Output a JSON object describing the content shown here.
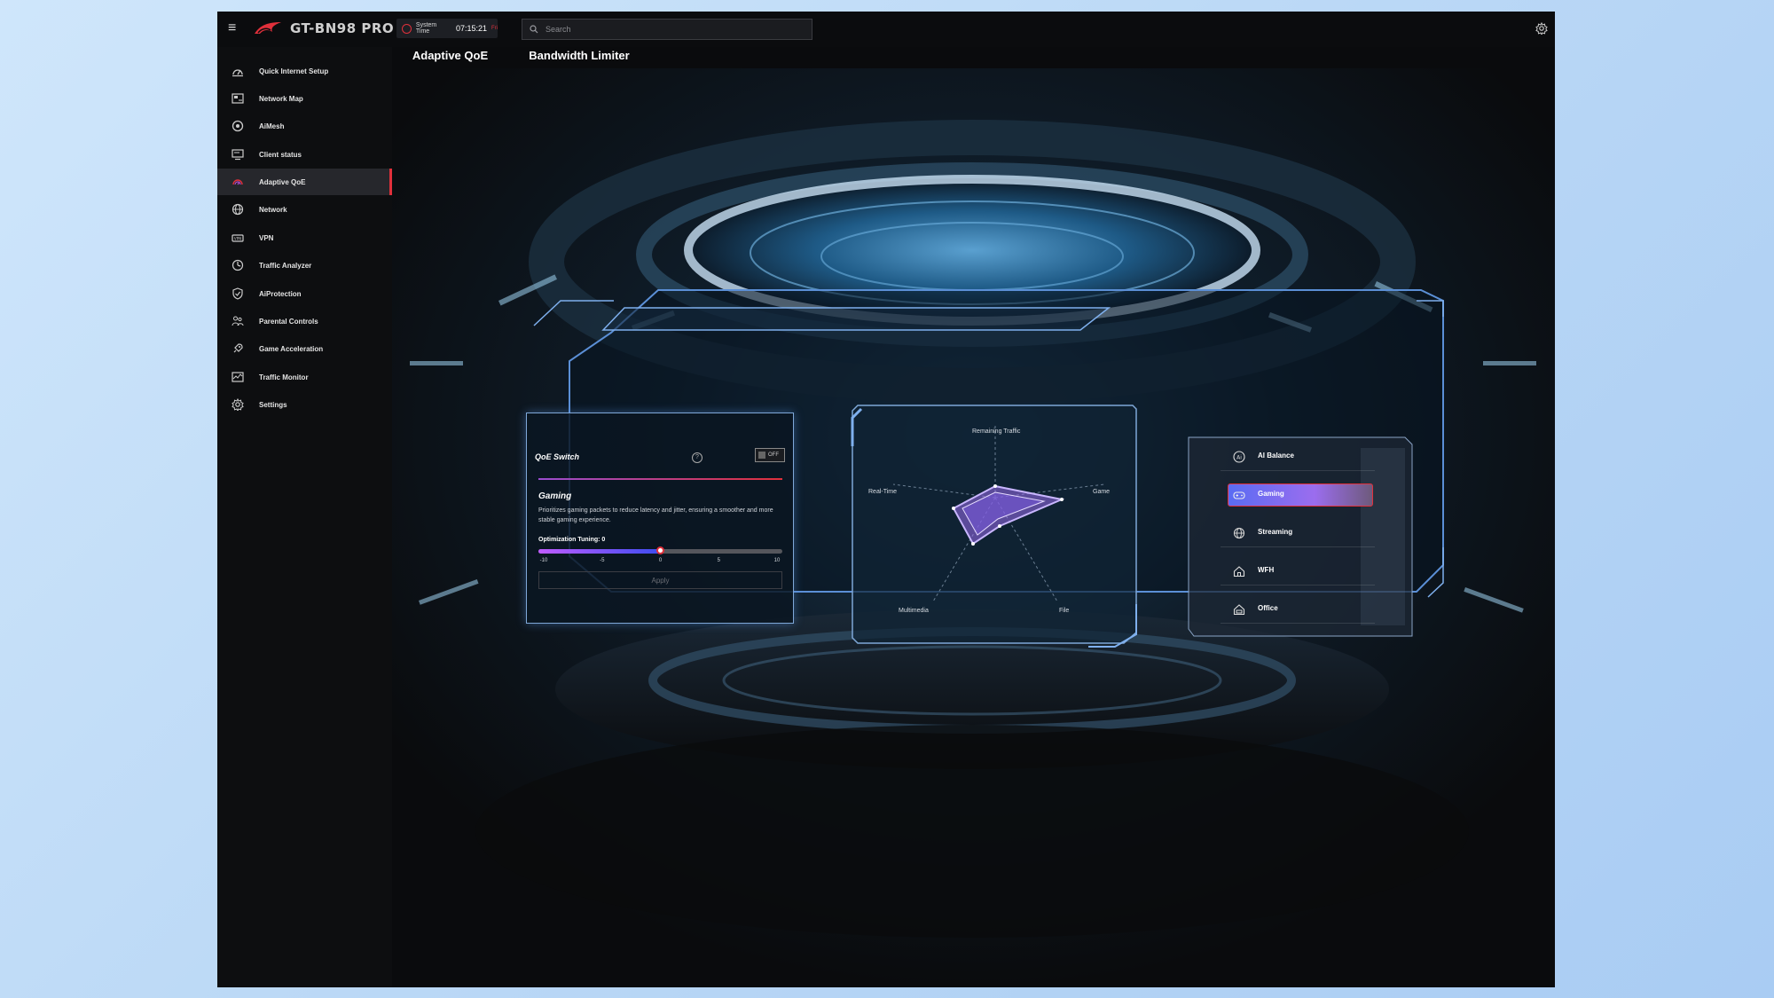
{
  "app": {
    "model": "GT-BN98 PRO",
    "system_time_label": "System Time",
    "system_time": "07:15:21",
    "day": "Fri",
    "search_placeholder": "Search"
  },
  "sidebar": {
    "items": [
      {
        "label": "Quick Internet Setup",
        "icon": "speedometer-icon"
      },
      {
        "label": "Network Map",
        "icon": "network-map-icon"
      },
      {
        "label": "AiMesh",
        "icon": "aimesh-icon"
      },
      {
        "label": "Client status",
        "icon": "monitor-icon"
      },
      {
        "label": "Adaptive QoE",
        "icon": "qoe-gauge-icon",
        "active": true
      },
      {
        "label": "Network",
        "icon": "globe-icon"
      },
      {
        "label": "VPN",
        "icon": "vpn-icon"
      },
      {
        "label": "Traffic Analyzer",
        "icon": "clock-chart-icon"
      },
      {
        "label": "AiProtection",
        "icon": "shield-icon"
      },
      {
        "label": "Parental Controls",
        "icon": "family-icon"
      },
      {
        "label": "Game Acceleration",
        "icon": "rocket-icon"
      },
      {
        "label": "Traffic Monitor",
        "icon": "traffic-monitor-icon"
      },
      {
        "label": "Settings",
        "icon": "gear-icon"
      }
    ]
  },
  "tabs": [
    {
      "label": "Adaptive QoE",
      "active": true
    },
    {
      "label": "Bandwidth Limiter",
      "active": false
    }
  ],
  "qoe_panel": {
    "title": "QoE Switch",
    "toggle_state": "OFF",
    "mode_title": "Gaming",
    "mode_description": "Prioritizes gaming packets to reduce latency and jitter, ensuring a smoother and more stable gaming experience.",
    "tuning_label": "Optimization Tuning: 0",
    "tuning_value": 0,
    "tuning_min": -10,
    "tuning_max": 10,
    "ticks": [
      "-10",
      "-5",
      "0",
      "5",
      "10"
    ],
    "apply_label": "Apply"
  },
  "radar": {
    "axes": [
      "Remaining Traffic",
      "Game",
      "File",
      "Multimedia",
      "Real-Time"
    ]
  },
  "modes": [
    {
      "label": "AI Balance",
      "icon": "ai-icon",
      "selected": false
    },
    {
      "label": "Gaming",
      "icon": "gamepad-icon",
      "selected": true
    },
    {
      "label": "Streaming",
      "icon": "globe-icon",
      "selected": false
    },
    {
      "label": "WFH",
      "icon": "home-icon",
      "selected": false
    },
    {
      "label": "Office",
      "icon": "office-icon",
      "selected": false
    }
  ],
  "colors": {
    "accent": "#e0303b",
    "glow": "#7fa8d8",
    "radar_fill": "#9b6dee"
  }
}
